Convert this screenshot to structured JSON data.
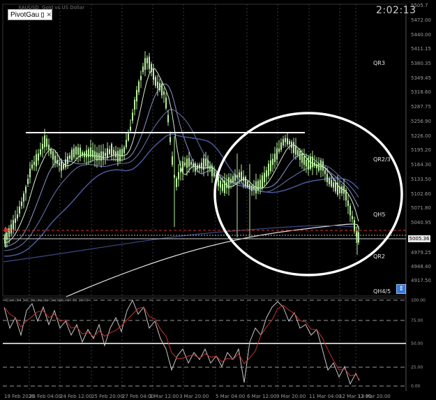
{
  "window": {
    "tab_label": "PivotGau",
    "symbol_title": "XAUUSD, Gold vs US Dollar",
    "clock": "2:02:13",
    "current_price": "5005.36"
  },
  "price_axis": {
    "labels": [
      "5505.7",
      "5472.00",
      "5440.00",
      "5411.15",
      "5380.35",
      "5349.45",
      "5318.60",
      "5287.75",
      "5256.90",
      "5226.00",
      "5195.20",
      "5164.30",
      "5133.50",
      "5102.60",
      "5071.80",
      "5040.95",
      "4979.25",
      "4948.40",
      "4917.50"
    ]
  },
  "pivot_labels": [
    "QR3",
    "QR2/3",
    "QH5",
    "QR2",
    "QH4/5"
  ],
  "date_axis": {
    "labels": [
      "19 Feb 2026",
      "23 Feb 04:00",
      "24 Feb 12:00",
      "25 Feb 20:00",
      "27 Feb 04:00",
      "2 Mar 12:00",
      "3 Mar 20:00",
      "5 Mar 04:00",
      "6 Mar 12:00",
      "9 Mar 20:00",
      "11 Mar 04:00",
      "12 Mar 12:00",
      "13 Mar 20:00"
    ]
  },
  "oscillator": {
    "title": "Stoch(14,3,3) Stochastic Oscillator 14.59 16.45",
    "levels": [
      "100.00",
      "75.00",
      "50.00",
      "25.00",
      "0.00"
    ]
  },
  "colors": {
    "background": "#000000",
    "candle": "#b8f0a0",
    "pivot_line": "#ffffff",
    "red_dash": "#e03030",
    "ma_slow": "#e0e0e0",
    "ma_blue": "#4a5a9a",
    "stoch_main": "#c8c8c8",
    "stoch_signal": "#c83030",
    "highlight_circle": "#ffffff"
  }
}
